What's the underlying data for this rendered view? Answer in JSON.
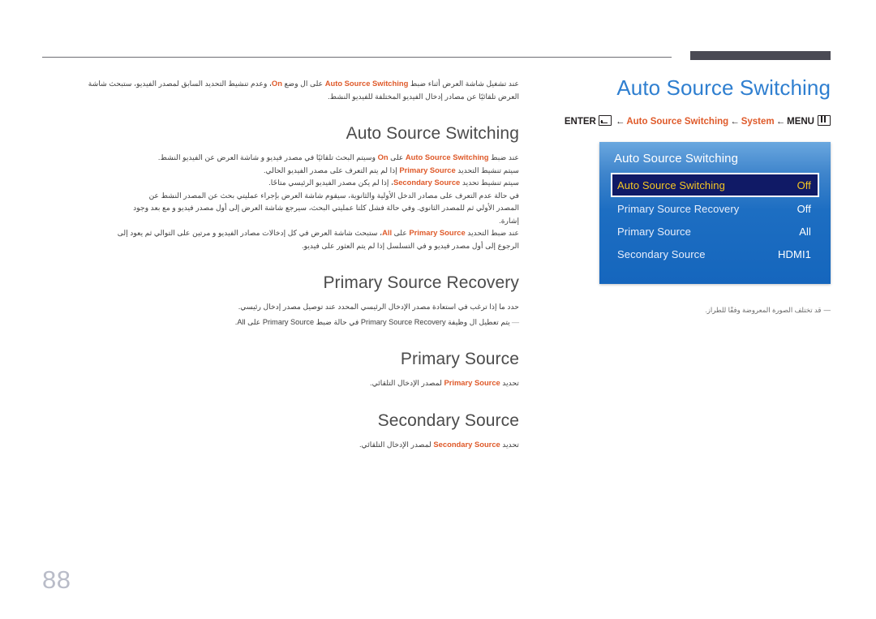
{
  "header": {
    "rule_left": true,
    "rule_right": true
  },
  "page": {
    "number": "88"
  },
  "right": {
    "title": "Auto Source Switching",
    "nav": {
      "enter_label": "ENTER",
      "enter_icon": "enter-key-icon",
      "arrow": "←",
      "item1": "Auto Source Switching",
      "item2": "System",
      "menu_label": "MENU",
      "menu_icon": "menu-key-icon"
    },
    "note_dash": "―",
    "note_text": "قد تختلف الصورة المعروضة وفقًا للطراز."
  },
  "osd": {
    "title": "Auto Source Switching",
    "rows": [
      {
        "label": "Auto Source Switching",
        "value": "Off",
        "selected": true
      },
      {
        "label": "Primary Source Recovery",
        "value": "Off",
        "selected": false
      },
      {
        "label": "Primary Source",
        "value": "All",
        "selected": false
      },
      {
        "label": "Secondary Source",
        "value": "HDMI1",
        "selected": false
      }
    ]
  },
  "left": {
    "intro": {
      "p1_a": "عند تشغيل شاشة العرض أثناء ضبط ",
      "p1_kw1": "Auto Source Switching",
      "p1_b": " على ال وضع ",
      "p1_kw2": "On",
      "p1_c": "، وعدم تنشيط التحديد السابق لمصدر الفيديو، ستبحث شاشة",
      "p2": "العرض تلقائيًا عن مصادر إدخال الفيديو المختلفة للفيديو النشط."
    },
    "sections": [
      {
        "title": "Auto Source Switching",
        "lines": [
          {
            "parts": [
              {
                "t": "عند ضبط ",
                "kw": false
              },
              {
                "t": "Auto Source Switching",
                "kw": true
              },
              {
                "t": " على ",
                "kw": false
              },
              {
                "t": "On",
                "kw": true
              },
              {
                "t": " وسيتم البحث تلقائيًا في مصدر فيديو و شاشة العرض عن الفيديو النشط.",
                "kw": false
              }
            ]
          },
          {
            "parts": [
              {
                "t": "سيتم تنشيط التحديد ",
                "kw": false
              },
              {
                "t": "Primary Source",
                "kw": true
              },
              {
                "t": " إذا لم يتم التعرف على مصدر الفيديو الحالي.",
                "kw": false
              }
            ]
          },
          {
            "parts": [
              {
                "t": "سيتم تنشيط تحديد ",
                "kw": false
              },
              {
                "t": "Secondary Source",
                "kw": true
              },
              {
                "t": "، إذا لم يكن مصدر الفيديو الرئيسي متاحًا.",
                "kw": false
              }
            ]
          },
          {
            "parts": [
              {
                "t": "في حالة عدم التعرف على مصادر الدخل الأولية والثانوية، سيقوم شاشة العرض بإجراء عمليتي بحث عن المصدر النشط عن",
                "kw": false
              }
            ]
          },
          {
            "parts": [
              {
                "t": "المصدر الأولي ثم للمصدر الثانوي. وفي حالة فشل كلتا عمليتي البحث، سيرجع شاشة العرض إلى أول مصدر فيديو و مع بعد وجود",
                "kw": false
              }
            ]
          },
          {
            "parts": [
              {
                "t": "إشارة.",
                "kw": false
              }
            ]
          },
          {
            "parts": [
              {
                "t": "عند ضبط التحديد ",
                "kw": false
              },
              {
                "t": "Primary Source",
                "kw": true
              },
              {
                "t": " على ",
                "kw": false
              },
              {
                "t": "All",
                "kw": true
              },
              {
                "t": "، ستبحث شاشة العرض في كل إدخالات مصادر الفيديو و مرتين على التوالي ثم يعود إلى",
                "kw": false
              }
            ]
          },
          {
            "parts": [
              {
                "t": "الرجوع إلى أول مصدر فيديو و في التسلسل إذا لم يتم العثور على فيديو.",
                "kw": false
              }
            ]
          }
        ]
      },
      {
        "title": "Primary Source Recovery",
        "lines": [
          {
            "parts": [
              {
                "t": "حدد ما إذا ترغب في استعادة مصدر الإدخال الرئيسي المحدد عند توصيل مصدر إدخال رئيسي.",
                "kw": false
              }
            ]
          }
        ],
        "note": {
          "dash": "―",
          "parts": [
            {
              "t": "يتم تعطيل ال وظيفة ",
              "kw": false
            },
            {
              "t": "Primary Source Recovery",
              "kw": true
            },
            {
              "t": " في حالة ضبط ",
              "kw": false
            },
            {
              "t": "Primary Source",
              "kw": true
            },
            {
              "t": " على ",
              "kw": false
            },
            {
              "t": "All",
              "kw": true
            },
            {
              "t": ".",
              "kw": false
            }
          ]
        }
      },
      {
        "title": "Primary Source",
        "lines": [
          {
            "parts": [
              {
                "t": "تحديد ",
                "kw": false
              },
              {
                "t": "Primary Source",
                "kw": true
              },
              {
                "t": " لمصدر الإدخال التلقائي.",
                "kw": false
              }
            ]
          }
        ]
      },
      {
        "title": "Secondary Source",
        "lines": [
          {
            "parts": [
              {
                "t": "تحديد ",
                "kw": false
              },
              {
                "t": "Secondary Source",
                "kw": true
              },
              {
                "t": " لمصدر الإدخال التلقائي.",
                "kw": false
              }
            ]
          }
        ]
      }
    ]
  },
  "colors": {
    "title_blue": "#2f7fd0",
    "accent_orange": "#df5a2a",
    "osd_blue": "#1d6ec2",
    "osd_selected_bg": "#101a66",
    "osd_selected_text": "#f5c623",
    "page_num": "#b9bcc8"
  }
}
